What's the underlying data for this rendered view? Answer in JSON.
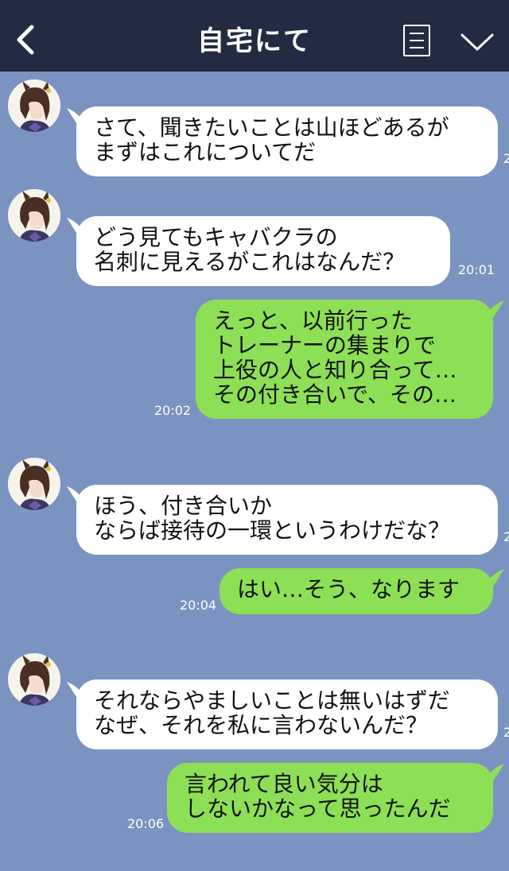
{
  "header": {
    "title": "自宅にて",
    "back_icon": "chevron-left-icon",
    "menu_icon": "menu-list-icon",
    "expand_icon": "chevron-down-icon",
    "colors": {
      "bar": "#232b42",
      "background": "#7b93c0",
      "incoming": "#ffffff",
      "outgoing": "#8de055"
    }
  },
  "messages": [
    {
      "side": "in",
      "text": "さて、聞きたいことは山ほどあるが\nまずはこれについてだ",
      "time": ""
    },
    {
      "side": "in",
      "text": "どう見てもキャバクラの\n名刺に見えるがこれはなんだ？",
      "time": "20:01"
    },
    {
      "side": "out",
      "text": "えっと、以前行った\nトレーナーの集まりで\n上役の人と知り合って…\nその付き合いで、その…",
      "time": "20:02"
    },
    {
      "side": "in",
      "text": "ほう、付き合いか\nならば接待の一環というわけだな？",
      "time": ""
    },
    {
      "side": "out",
      "text": "はい…そう、なります",
      "time": "20:04"
    },
    {
      "side": "in",
      "text": "それならやましいことは無いはずだ\nなぜ、それを私に言わないんだ？",
      "time": ""
    },
    {
      "side": "out",
      "text": "言われて良い気分は\nしないかなって思ったんだ",
      "time": "20:06"
    }
  ],
  "edge_timestamp_fragment": "2"
}
